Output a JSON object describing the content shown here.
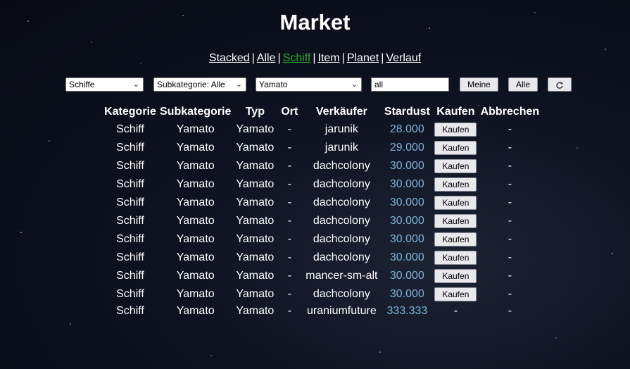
{
  "page": {
    "title": "Market"
  },
  "nav": {
    "items": [
      "Stacked",
      "Alle",
      "Schiff",
      "Item",
      "Planet",
      "Verlauf"
    ],
    "active": "Schiff",
    "separator": "|"
  },
  "filters": {
    "category": "Schiffe",
    "subcategory": "Subkategorie: Alle",
    "type": "Yamato",
    "search": "all",
    "mine_label": "Meine",
    "all_label": "Alle",
    "refresh_icon": "refresh-icon"
  },
  "table": {
    "headers": [
      "Kategorie",
      "Subkategorie",
      "Typ",
      "Ort",
      "Verkäufer",
      "Stardust",
      "Kaufen",
      "Abbrechen"
    ],
    "buy_label": "Kaufen",
    "rows": [
      {
        "kategorie": "Schiff",
        "subkategorie": "Yamato",
        "typ": "Yamato",
        "ort": "-",
        "verkaeufer": "jarunik",
        "stardust": "28.000",
        "kaufen": true,
        "abbrechen": "-"
      },
      {
        "kategorie": "Schiff",
        "subkategorie": "Yamato",
        "typ": "Yamato",
        "ort": "-",
        "verkaeufer": "jarunik",
        "stardust": "29.000",
        "kaufen": true,
        "abbrechen": "-"
      },
      {
        "kategorie": "Schiff",
        "subkategorie": "Yamato",
        "typ": "Yamato",
        "ort": "-",
        "verkaeufer": "dachcolony",
        "stardust": "30.000",
        "kaufen": true,
        "abbrechen": "-"
      },
      {
        "kategorie": "Schiff",
        "subkategorie": "Yamato",
        "typ": "Yamato",
        "ort": "-",
        "verkaeufer": "dachcolony",
        "stardust": "30.000",
        "kaufen": true,
        "abbrechen": "-"
      },
      {
        "kategorie": "Schiff",
        "subkategorie": "Yamato",
        "typ": "Yamato",
        "ort": "-",
        "verkaeufer": "dachcolony",
        "stardust": "30.000",
        "kaufen": true,
        "abbrechen": "-"
      },
      {
        "kategorie": "Schiff",
        "subkategorie": "Yamato",
        "typ": "Yamato",
        "ort": "-",
        "verkaeufer": "dachcolony",
        "stardust": "30.000",
        "kaufen": true,
        "abbrechen": "-"
      },
      {
        "kategorie": "Schiff",
        "subkategorie": "Yamato",
        "typ": "Yamato",
        "ort": "-",
        "verkaeufer": "dachcolony",
        "stardust": "30.000",
        "kaufen": true,
        "abbrechen": "-"
      },
      {
        "kategorie": "Schiff",
        "subkategorie": "Yamato",
        "typ": "Yamato",
        "ort": "-",
        "verkaeufer": "dachcolony",
        "stardust": "30.000",
        "kaufen": true,
        "abbrechen": "-"
      },
      {
        "kategorie": "Schiff",
        "subkategorie": "Yamato",
        "typ": "Yamato",
        "ort": "-",
        "verkaeufer": "mancer-sm-alt",
        "stardust": "30.000",
        "kaufen": true,
        "abbrechen": "-"
      },
      {
        "kategorie": "Schiff",
        "subkategorie": "Yamato",
        "typ": "Yamato",
        "ort": "-",
        "verkaeufer": "dachcolony",
        "stardust": "30.000",
        "kaufen": true,
        "abbrechen": "-"
      },
      {
        "kategorie": "Schiff",
        "subkategorie": "Yamato",
        "typ": "Yamato",
        "ort": "-",
        "verkaeufer": "uraniumfuture",
        "stardust": "333.333",
        "kaufen": false,
        "kaufen_text": "-",
        "abbrechen": "-"
      }
    ]
  },
  "colors": {
    "active_link": "#2fa72f",
    "stardust": "#7fb2d6",
    "background": "#0d1220"
  }
}
